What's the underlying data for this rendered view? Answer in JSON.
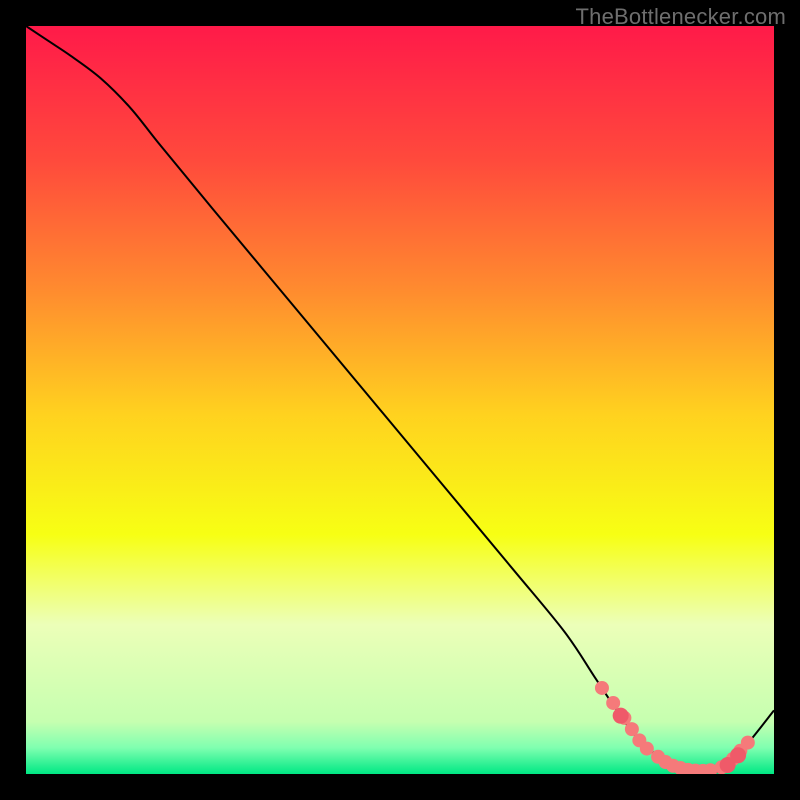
{
  "watermark": "TheBottlenecker.com",
  "chart_data": {
    "type": "line",
    "title": "",
    "xlabel": "",
    "ylabel": "",
    "xlim": [
      0,
      100
    ],
    "ylim": [
      0,
      100
    ],
    "grid": false,
    "background_gradient": {
      "type": "vertical",
      "stops": [
        {
          "pos": 0.0,
          "color": "#ff1a49"
        },
        {
          "pos": 0.18,
          "color": "#ff4a3c"
        },
        {
          "pos": 0.35,
          "color": "#ff8a2f"
        },
        {
          "pos": 0.52,
          "color": "#ffd21f"
        },
        {
          "pos": 0.68,
          "color": "#f7ff14"
        },
        {
          "pos": 0.8,
          "color": "#ecffb8"
        },
        {
          "pos": 0.93,
          "color": "#c6ffb0"
        },
        {
          "pos": 0.965,
          "color": "#7fffb0"
        },
        {
          "pos": 1.0,
          "color": "#00e884"
        }
      ]
    },
    "series": [
      {
        "name": "curve",
        "color": "#000000",
        "stroke_width": 2,
        "x": [
          0,
          3,
          6,
          10,
          14,
          18,
          25,
          35,
          45,
          55,
          65,
          72,
          76,
          79,
          82,
          86,
          90,
          93,
          96,
          100
        ],
        "y": [
          100,
          98,
          96,
          93,
          89,
          84,
          75.5,
          63.5,
          51.5,
          39.5,
          27.5,
          19,
          13,
          8.5,
          4.5,
          1.5,
          0.4,
          0.5,
          3.5,
          8.5
        ]
      }
    ],
    "points": [
      {
        "name": "dots-soft",
        "color": "#f57a7a",
        "r": 7,
        "x": [
          77,
          78.5,
          80,
          81,
          82,
          83,
          84.5,
          85.5,
          86.5,
          87.5,
          88.5,
          89.5,
          90.5,
          91.5,
          93,
          94.5,
          95.5,
          96.5
        ],
        "y": [
          11.5,
          9.5,
          7.5,
          6.0,
          4.5,
          3.4,
          2.3,
          1.6,
          1.1,
          0.8,
          0.55,
          0.45,
          0.42,
          0.5,
          0.9,
          2.0,
          3.1,
          4.2
        ]
      },
      {
        "name": "dots-strong",
        "color": "#ef5a69",
        "r": 8,
        "x": [
          79.5,
          93.8,
          95.2
        ],
        "y": [
          7.8,
          1.2,
          2.5
        ]
      }
    ]
  }
}
